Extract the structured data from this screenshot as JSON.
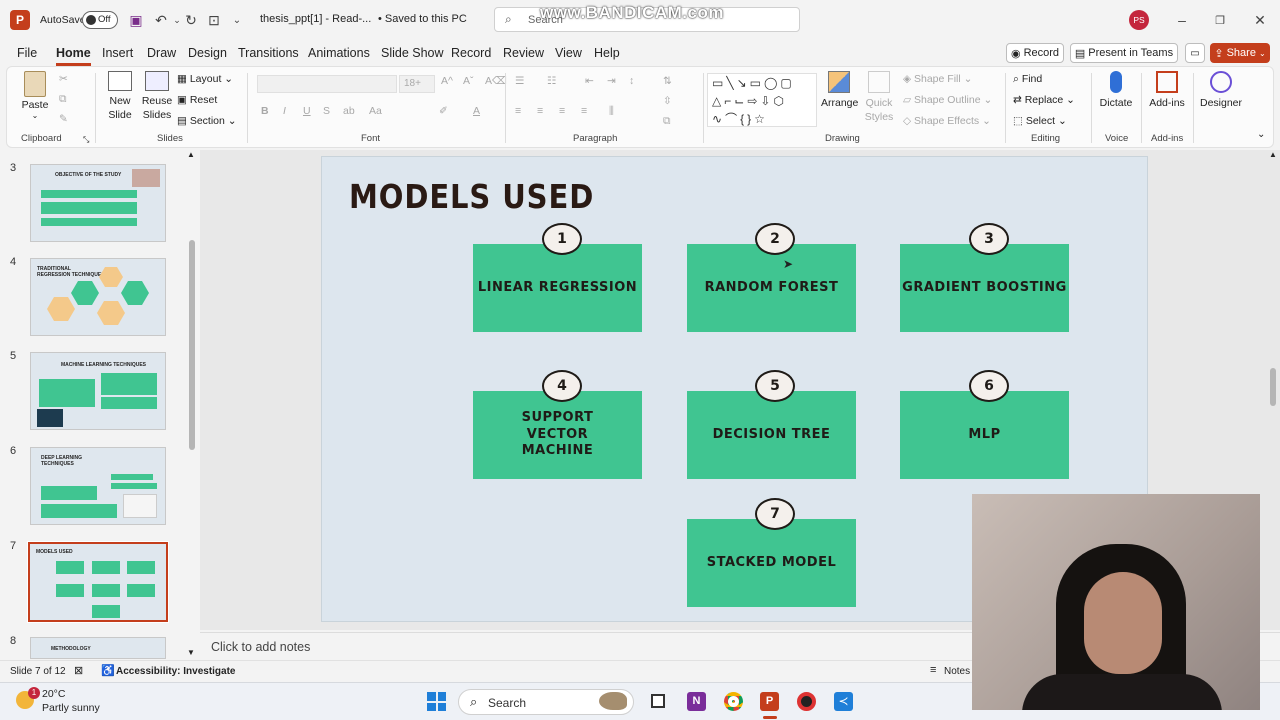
{
  "titlebar": {
    "app_icon": "P",
    "autosave_label": "AutoSave",
    "autosave_state": "Off",
    "filename": "thesis_ppt[1]  -  Read-...",
    "saved_status": "• Saved to this PC",
    "search_placeholder": "Search",
    "watermark": "www.BANDICAM.com",
    "user_initials": "PS"
  },
  "tabs": [
    "File",
    "Home",
    "Insert",
    "Draw",
    "Design",
    "Transitions",
    "Animations",
    "Slide Show",
    "Record",
    "Review",
    "View",
    "Help"
  ],
  "tab_actions": {
    "record": "Record",
    "present": "Present in Teams",
    "share": "Share"
  },
  "ribbon": {
    "clipboard": {
      "paste": "Paste",
      "label": "Clipboard"
    },
    "slides": {
      "new_slide": "New Slide",
      "reuse": "Reuse Slides",
      "layout": "Layout",
      "reset": "Reset",
      "section": "Section",
      "label": "Slides"
    },
    "font": {
      "size": "18+",
      "label": "Font",
      "bold": "B",
      "italic": "I",
      "underline": "U",
      "strike": "S",
      "spacing": "ab"
    },
    "paragraph": {
      "label": "Paragraph"
    },
    "drawing": {
      "arrange": "Arrange",
      "quick_styles": "Quick Styles",
      "fill": "Shape Fill",
      "outline": "Shape Outline",
      "effects": "Shape Effects",
      "label": "Drawing"
    },
    "editing": {
      "find": "Find",
      "replace": "Replace",
      "select": "Select",
      "label": "Editing"
    },
    "voice": {
      "dictate": "Dictate",
      "label": "Voice"
    },
    "addins": {
      "addins": "Add-ins",
      "label": "Add-ins"
    },
    "designer": {
      "designer": "Designer"
    }
  },
  "thumbnails": [
    {
      "num": "3",
      "title": "OBJECTIVE OF THE STUDY"
    },
    {
      "num": "4",
      "title": "TRADITIONAL REGRESSION TECHNIQUES"
    },
    {
      "num": "5",
      "title": "MACHINE LEARNING TECHNIQUES"
    },
    {
      "num": "6",
      "title": "DEEP LEARNING TECHNIQUES"
    },
    {
      "num": "7",
      "title": "MODELS USED"
    },
    {
      "num": "8",
      "title": "METHODOLOGY"
    }
  ],
  "slide": {
    "title": "MODELS USED",
    "models": [
      {
        "num": "1",
        "name": "LINEAR REGRESSION"
      },
      {
        "num": "2",
        "name": "RANDOM FOREST"
      },
      {
        "num": "3",
        "name": "GRADIENT BOOSTING"
      },
      {
        "num": "4",
        "name": "SUPPORT VECTOR MACHINE"
      },
      {
        "num": "5",
        "name": "DECISION TREE"
      },
      {
        "num": "6",
        "name": "MLP"
      },
      {
        "num": "7",
        "name": "STACKED MODEL"
      }
    ]
  },
  "notes_placeholder": "Click to add notes",
  "status": {
    "slide_info": "Slide 7 of 12",
    "accessibility": "Accessibility: Investigate",
    "notes": "Notes"
  },
  "taskbar": {
    "weather_temp": "20°C",
    "weather_desc": "Partly sunny",
    "weather_badge": "1",
    "search": "Search"
  },
  "colors": {
    "accent": "#c43e1c",
    "box": "#40c591",
    "slide_bg": "#dde6ee",
    "title": "#2a1a14"
  }
}
